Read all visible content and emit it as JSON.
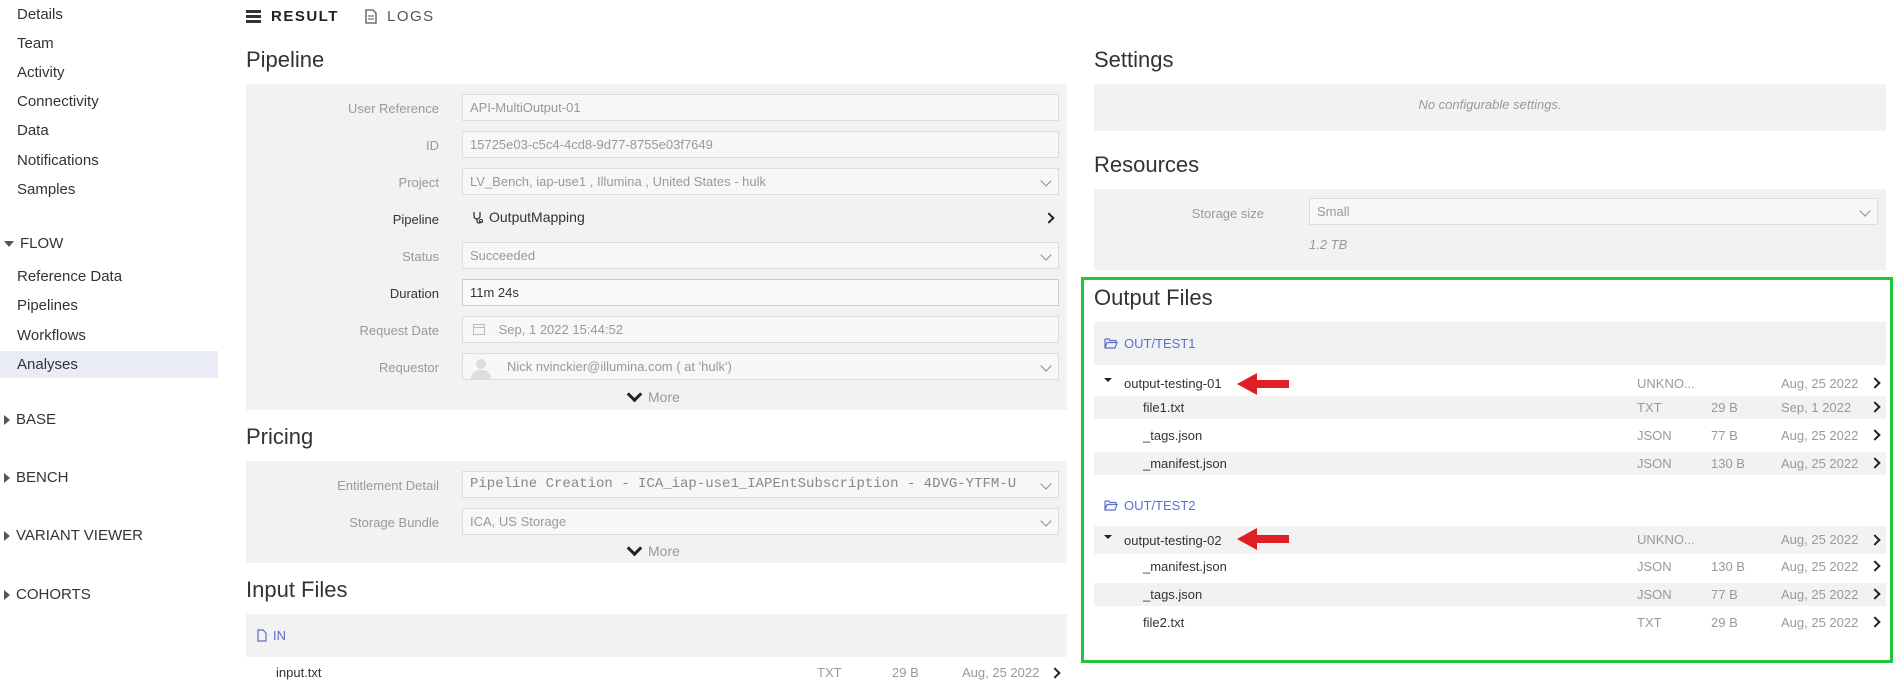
{
  "sidebar": {
    "items_top": [
      "Details",
      "Team",
      "Activity",
      "Connectivity",
      "Data",
      "Notifications",
      "Samples"
    ],
    "flow_section": "FLOW",
    "flow_items": [
      "Reference Data",
      "Pipelines",
      "Workflows",
      "Analyses"
    ],
    "sections": [
      "BASE",
      "BENCH",
      "VARIANT VIEWER",
      "COHORTS"
    ]
  },
  "tabs": {
    "result": "RESULT",
    "logs": "LOGS"
  },
  "pipeline": {
    "title": "Pipeline",
    "fields": {
      "user_reference_label": "User Reference",
      "user_reference_value": "API-MultiOutput-01",
      "id_label": "ID",
      "id_value": "15725e03-c5c4-4cd8-9d77-8755e03f7649",
      "project_label": "Project",
      "project_value": "LV_Bench, iap-use1 , Illumina , United States - hulk",
      "pipeline_label": "Pipeline",
      "pipeline_value": "OutputMapping",
      "status_label": "Status",
      "status_value": "Succeeded",
      "duration_label": "Duration",
      "duration_value": "11m 24s",
      "request_date_label": "Request Date",
      "request_date_value": "Sep, 1 2022 15:44:52",
      "requestor_label": "Requestor",
      "requestor_value": "Nick nvinckier@illumina.com ( at 'hulk')"
    },
    "more": "More"
  },
  "pricing": {
    "title": "Pricing",
    "entitlement_label": "Entitlement Detail",
    "entitlement_value": "Pipeline Creation - ICA_iap-use1_IAPEntSubscription - 4DVG-YTFM-U",
    "storage_bundle_label": "Storage Bundle",
    "storage_bundle_value": "ICA, US Storage",
    "more": "More"
  },
  "input_files": {
    "title": "Input Files",
    "folder": "IN",
    "file": {
      "name": "input.txt",
      "type": "TXT",
      "size": "29 B",
      "date": "Aug, 25 2022"
    }
  },
  "settings": {
    "title": "Settings",
    "empty": "No configurable settings."
  },
  "resources": {
    "title": "Resources",
    "storage_size_label": "Storage size",
    "storage_size_value": "Small",
    "storage_capacity": "1.2 TB"
  },
  "output_files": {
    "title": "Output Files",
    "folder1": "OUT/TEST1",
    "group1": {
      "name": "output-testing-01",
      "type": "UNKNO...",
      "date": "Aug, 25 2022"
    },
    "group1_files": [
      {
        "name": "file1.txt",
        "type": "TXT",
        "size": "29 B",
        "date": "Sep, 1 2022"
      },
      {
        "name": "_tags.json",
        "type": "JSON",
        "size": "77 B",
        "date": "Aug, 25 2022"
      },
      {
        "name": "_manifest.json",
        "type": "JSON",
        "size": "130 B",
        "date": "Aug, 25 2022"
      }
    ],
    "folder2": "OUT/TEST2",
    "group2": {
      "name": "output-testing-02",
      "type": "UNKNO...",
      "date": "Aug, 25 2022"
    },
    "group2_files": [
      {
        "name": "_manifest.json",
        "type": "JSON",
        "size": "130 B",
        "date": "Aug, 25 2022"
      },
      {
        "name": "_tags.json",
        "type": "JSON",
        "size": "77 B",
        "date": "Aug, 25 2022"
      },
      {
        "name": "file2.txt",
        "type": "TXT",
        "size": "29 B",
        "date": "Aug, 25 2022"
      }
    ]
  },
  "colors": {
    "highlight_box": "#1fc63b",
    "annotation_arrow": "#e01e25",
    "link": "#5b6fd1"
  },
  "icons": [
    "list-icon",
    "document-icon",
    "pipeline-icon",
    "calendar-icon",
    "user-avatar-icon",
    "folder-open-icon",
    "file-icon",
    "chevron-right-icon",
    "chevron-down-icon",
    "red-arrow-annotation"
  ]
}
